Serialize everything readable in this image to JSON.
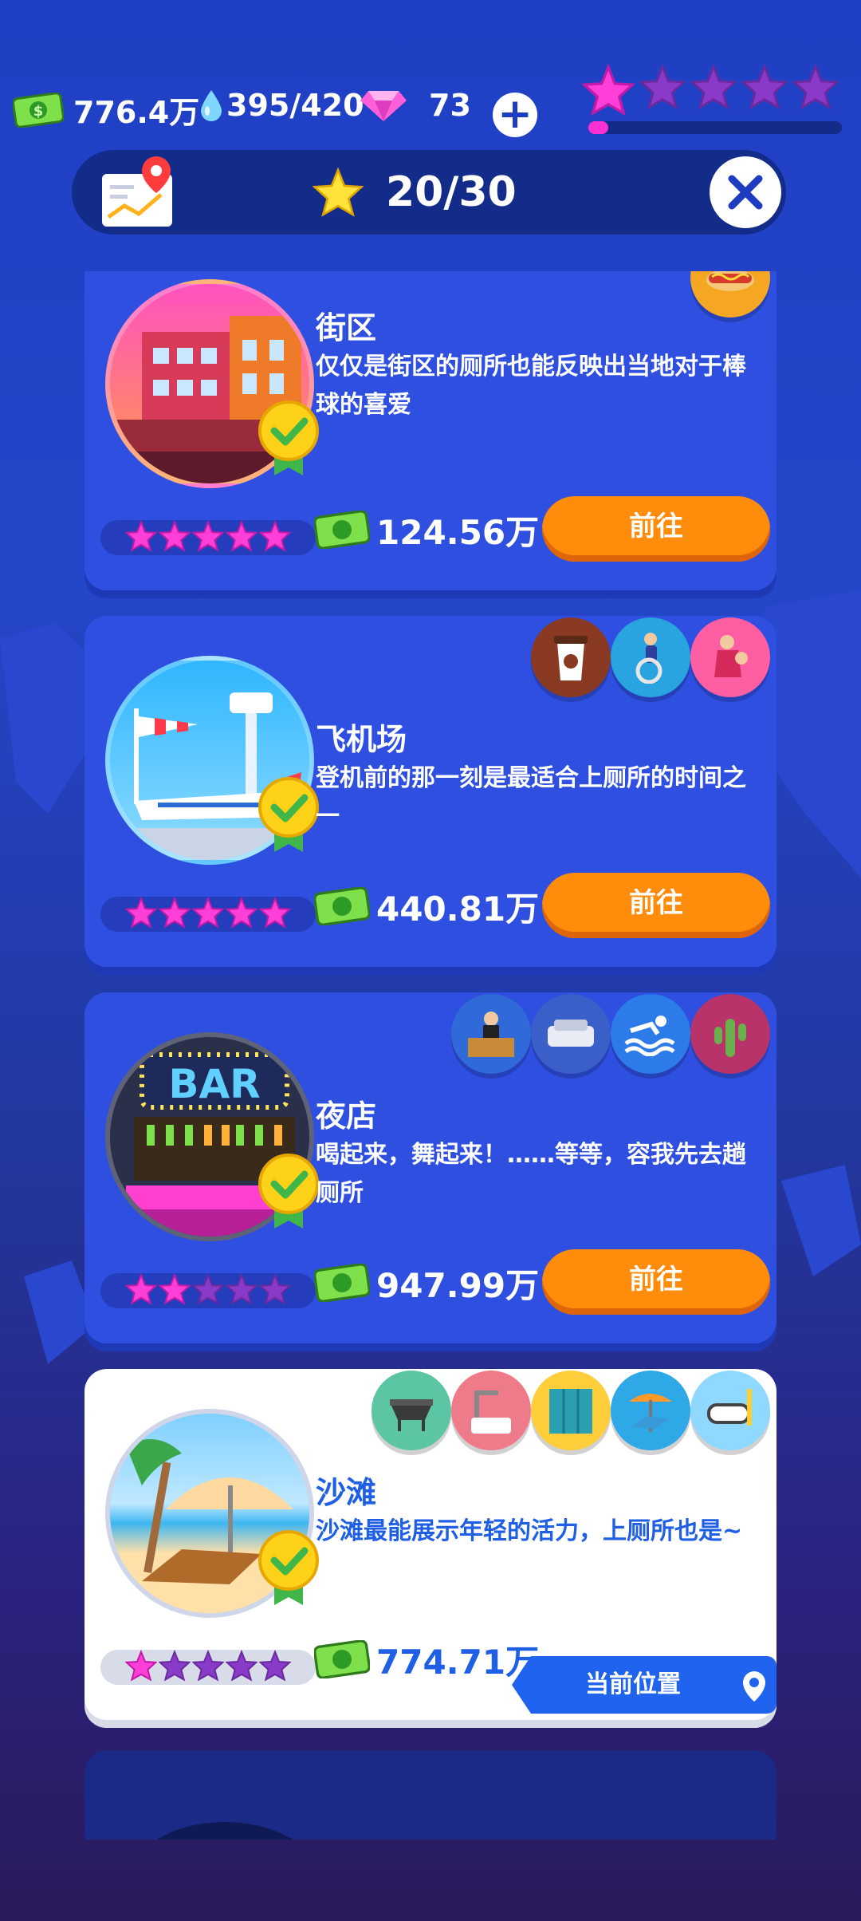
{
  "resources": {
    "cash": "776.4万",
    "water": "395/420",
    "gems": "73"
  },
  "level_stars": {
    "filled": 1,
    "total": 5,
    "progress": 0.08
  },
  "header": {
    "star_count": "20/30"
  },
  "colors": {
    "accent_orange": "#ff8c0a",
    "card_blue": "#2f4fe0",
    "star_pink": "#ff2fd1",
    "current_blue": "#1f63ee"
  },
  "locations": [
    {
      "title": "街区",
      "desc": "仅仅是街区的厕所也能反映出当地对于棒球的喜爱",
      "stars": 5,
      "price": "124.56万",
      "action": "前往",
      "facilities": [
        "hotdog-icon"
      ]
    },
    {
      "title": "飞机场",
      "desc": "登机前的那一刻是最适合上厕所的时间之一",
      "stars": 5,
      "price": "440.81万",
      "action": "前往",
      "facilities": [
        "coffee-cup-icon",
        "wheelchair-icon",
        "baby-care-icon"
      ]
    },
    {
      "title": "夜店",
      "desc": "喝起来，舞起来！……等等，容我先去趟厕所",
      "stars": 2,
      "price": "947.99万",
      "action": "前往",
      "facilities": [
        "bartender-icon",
        "sofa-icon",
        "swimming-icon",
        "cactus-icon"
      ]
    },
    {
      "title": "沙滩",
      "desc": "沙滩最能展示年轻的活力，上厕所也是~",
      "stars": 1,
      "price": "774.71万",
      "action": "当前位置",
      "facilities": [
        "grill-icon",
        "shower-icon",
        "locker-icon",
        "beach-chair-icon",
        "snorkel-icon"
      ]
    }
  ]
}
